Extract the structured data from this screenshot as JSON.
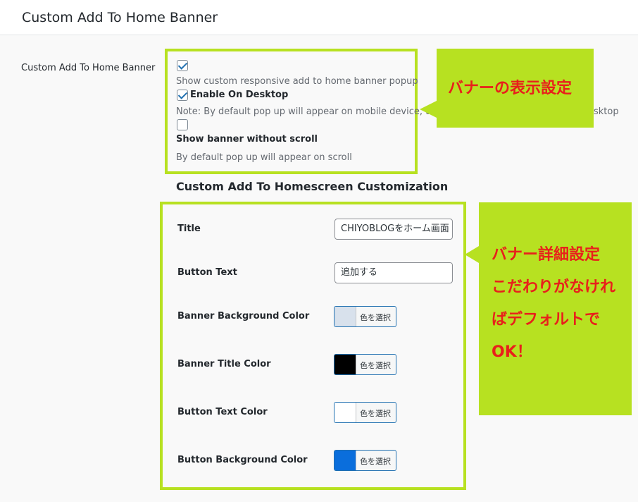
{
  "header": {
    "title": "Custom Add To Home Banner"
  },
  "settings_row": {
    "label": "Custom Add To Home Banner",
    "options": [
      {
        "checked": true,
        "label": "",
        "description": "Show custom responsive add to home banner popup"
      },
      {
        "checked": true,
        "label": "Enable On Desktop",
        "description": "Note: By default pop up will appear on mobile device, to",
        "description_tail": "sktop"
      },
      {
        "checked": false,
        "label": "Show banner without scroll",
        "description": "By default pop up will appear on scroll"
      }
    ]
  },
  "customization": {
    "title": "Custom Add To Homescreen Customization",
    "fields": [
      {
        "label": "Title",
        "type": "text",
        "value": "CHIYOBLOGをホーム画面"
      },
      {
        "label": "Button Text",
        "type": "text",
        "value": "追加する"
      },
      {
        "label": "Banner Background Color",
        "type": "color",
        "color": "#d8e1ec",
        "button_label": "色を選択"
      },
      {
        "label": "Banner Title Color",
        "type": "color",
        "color": "#000000",
        "button_label": "色を選択"
      },
      {
        "label": "Button Text Color",
        "type": "color",
        "color": "#ffffff",
        "button_label": "色を選択"
      },
      {
        "label": "Button Background Color",
        "type": "color",
        "color": "#0a6edc",
        "button_label": "色を選択"
      }
    ]
  },
  "callouts": {
    "display_settings": "バナーの表示設定",
    "detail_settings": [
      "バナー詳細設定",
      "こだわりがなけれ",
      "ばデフォルトで",
      "OK！"
    ]
  },
  "colors": {
    "highlight": "#b7e121",
    "callout_text": "#e8201b",
    "accent": "#2271b1"
  }
}
